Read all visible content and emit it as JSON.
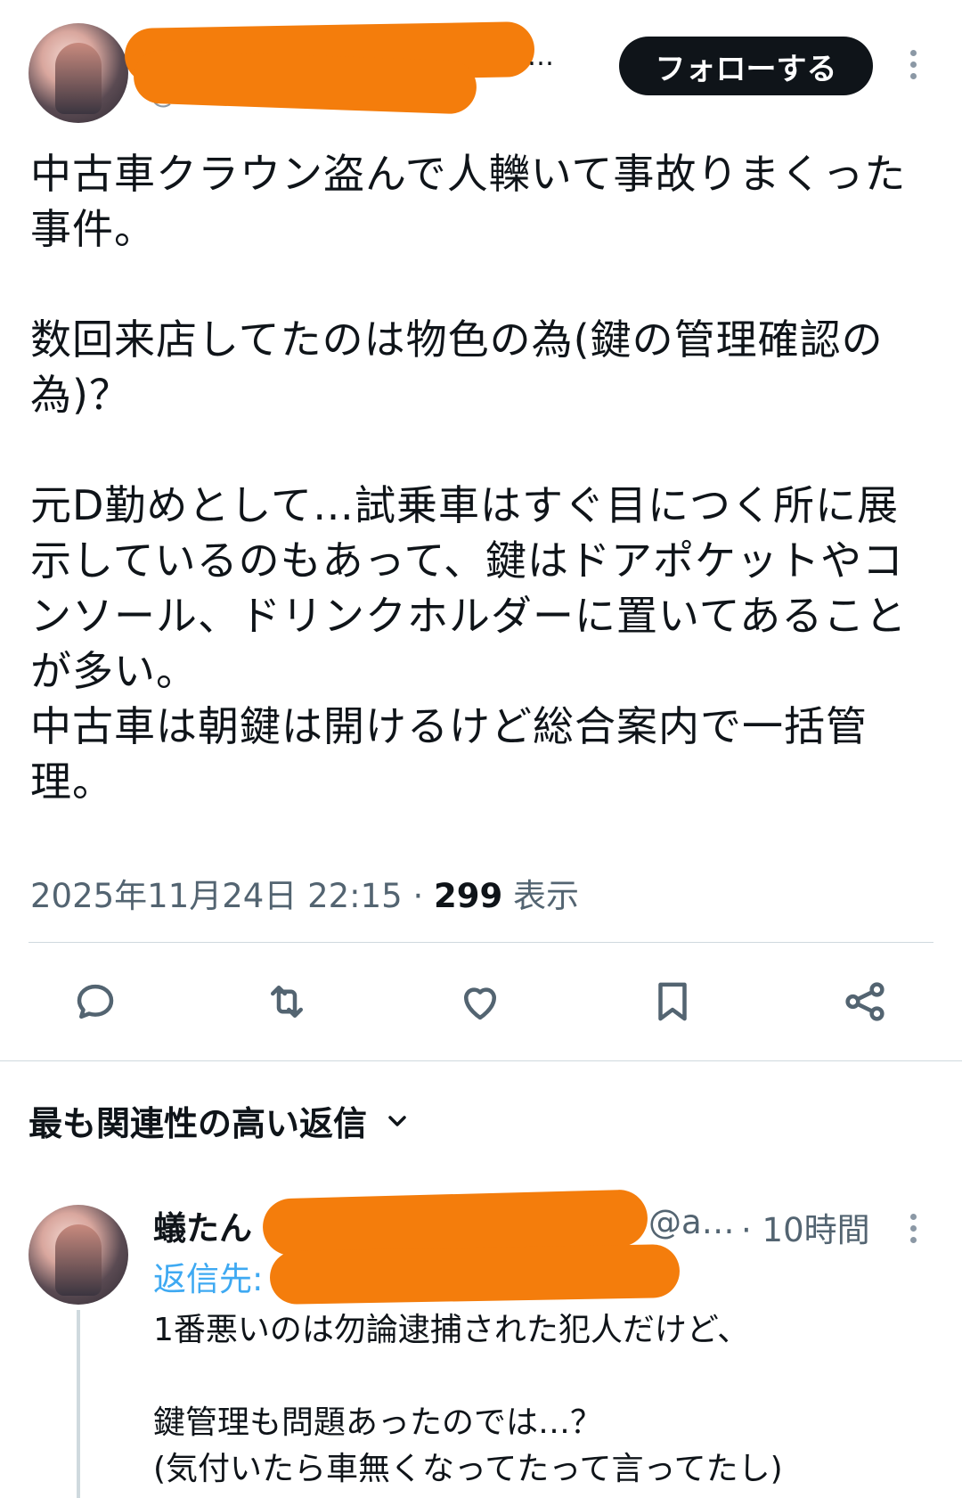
{
  "tweet": {
    "author_ellipsis": "…",
    "handle_prefix": "@",
    "follow_label": "フォローする",
    "text": "中古車クラウン盗んで人轢いて事故りまくった事件。\n\n数回来店してたのは物色の為(鍵の管理確認の為)？\n\n元D勤めとして…試乗車はすぐ目につく所に展示しているのもあって、鍵はドアポケットやコンソール、ドリンクホルダーに置いてあることが多い。\n中古車は朝鍵は開けるけど総合案内で一括管理。",
    "timestamp": "2025年11月24日 22:15",
    "separator": "·",
    "views_count": "299",
    "views_label": "表示"
  },
  "actions": {
    "reply_icon": "reply-icon",
    "retweet_icon": "retweet-icon",
    "like_icon": "heart-icon",
    "bookmark_icon": "bookmark-icon",
    "share_icon": "share-icon"
  },
  "replies_section": {
    "sort_label": "最も関連性の高い返信",
    "sort_icon": "chevron-down-icon"
  },
  "reply": {
    "name_visible": "蟻たん",
    "handle_visible": "@a…",
    "time": "· 10時間",
    "reply_to_label": "返信先:",
    "text": "1番悪いのは勿論逮捕された犯人だけど、\n\n鍵管理も問題あったのでは…？\n(気付いたら車無くなってたって言ってたし)"
  },
  "colors": {
    "redaction": "#f47d0c",
    "text_primary": "#0f1419",
    "text_secondary": "#536471",
    "link": "#1d9bf0",
    "follow_bg": "#0f1419"
  }
}
